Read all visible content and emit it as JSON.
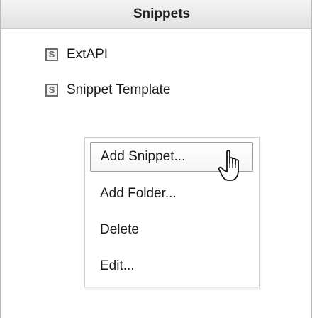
{
  "panel": {
    "title": "Snippets"
  },
  "snippets": {
    "items": [
      {
        "icon_letter": "S",
        "label": "ExtAPI"
      },
      {
        "icon_letter": "S",
        "label": "Snippet Template"
      }
    ]
  },
  "context_menu": {
    "items": [
      {
        "label": "Add Snippet...",
        "state": "hovered"
      },
      {
        "label": "Add Folder..."
      },
      {
        "label": "Delete"
      },
      {
        "label": "Edit..."
      }
    ]
  },
  "cursor": {
    "icon": "hand-pointer-icon"
  }
}
